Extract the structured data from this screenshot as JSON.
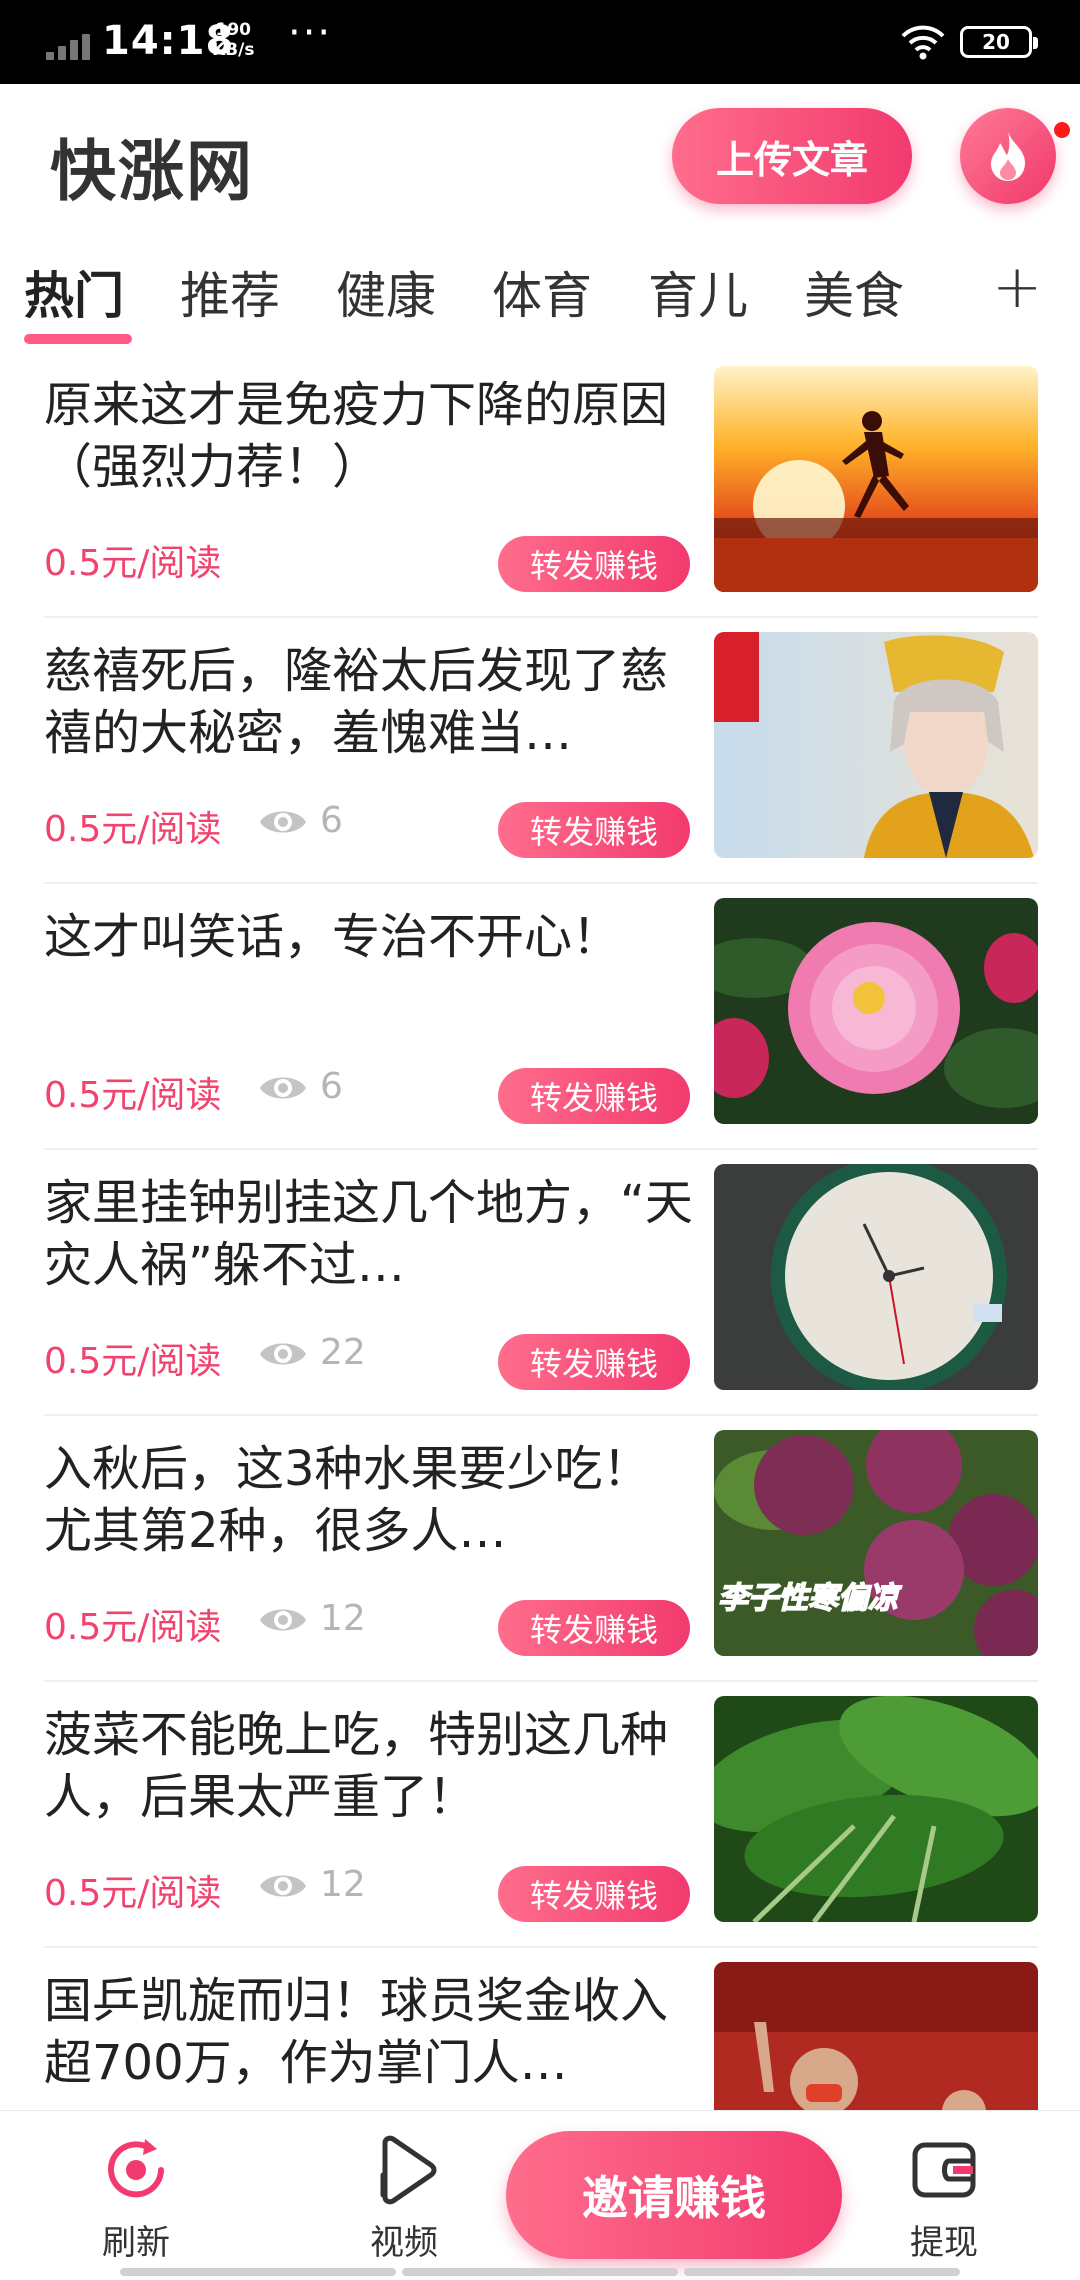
{
  "status_bar": {
    "time": "14:18",
    "speed_value": "190",
    "speed_unit": "KB/s",
    "more": "···",
    "battery": "20"
  },
  "header": {
    "title": "快涨网",
    "upload_label": "上传文章",
    "fire_icon": "fire-icon"
  },
  "tabs": [
    {
      "label": "热门",
      "active": true
    },
    {
      "label": "推荐"
    },
    {
      "label": "健康"
    },
    {
      "label": "体育"
    },
    {
      "label": "育儿"
    },
    {
      "label": "美食"
    }
  ],
  "tabs_add": "+",
  "articles": [
    {
      "title": "原来这才是免疫力下降的原因（强烈力荐！）",
      "price": "0.5元/阅读",
      "views": "",
      "share": "转发赚钱",
      "thumb": "sunset-runner"
    },
    {
      "title": "慈禧死后，隆裕太后发现了慈禧的大秘密，羞愧难当…",
      "price": "0.5元/阅读",
      "views": "6",
      "share": "转发赚钱",
      "thumb": "empress-costume"
    },
    {
      "title": "这才叫笑话，专治不开心！",
      "price": "0.5元/阅读",
      "views": "6",
      "share": "转发赚钱",
      "thumb": "pink-peony"
    },
    {
      "title": "家里挂钟别挂这几个地方，“天灾人祸”躲不过…",
      "price": "0.5元/阅读",
      "views": "22",
      "share": "转发赚钱",
      "thumb": "wall-clock"
    },
    {
      "title": "入秋后，这3种水果要少吃！尤其第2种，很多人…",
      "price": "0.5元/阅读",
      "views": "12",
      "share": "转发赚钱",
      "thumb": "plums",
      "thumb_caption": "李子性寒偏凉"
    },
    {
      "title": "菠菜不能晚上吃，特别这几种人，后果太严重了！",
      "price": "0.5元/阅读",
      "views": "12",
      "share": "转发赚钱",
      "thumb": "spinach"
    },
    {
      "title": "国乒凯旋而归！球员奖金收入超700万，作为掌门人…",
      "price": "",
      "views": "",
      "share": "",
      "thumb": "ping-pong-coach"
    }
  ],
  "bottom_nav": {
    "refresh": "刷新",
    "video": "视频",
    "invite": "邀请赚钱",
    "withdraw": "提现"
  },
  "colors": {
    "accent": "#f23a6e",
    "price": "#f0436e",
    "muted": "#b5b5b5"
  }
}
